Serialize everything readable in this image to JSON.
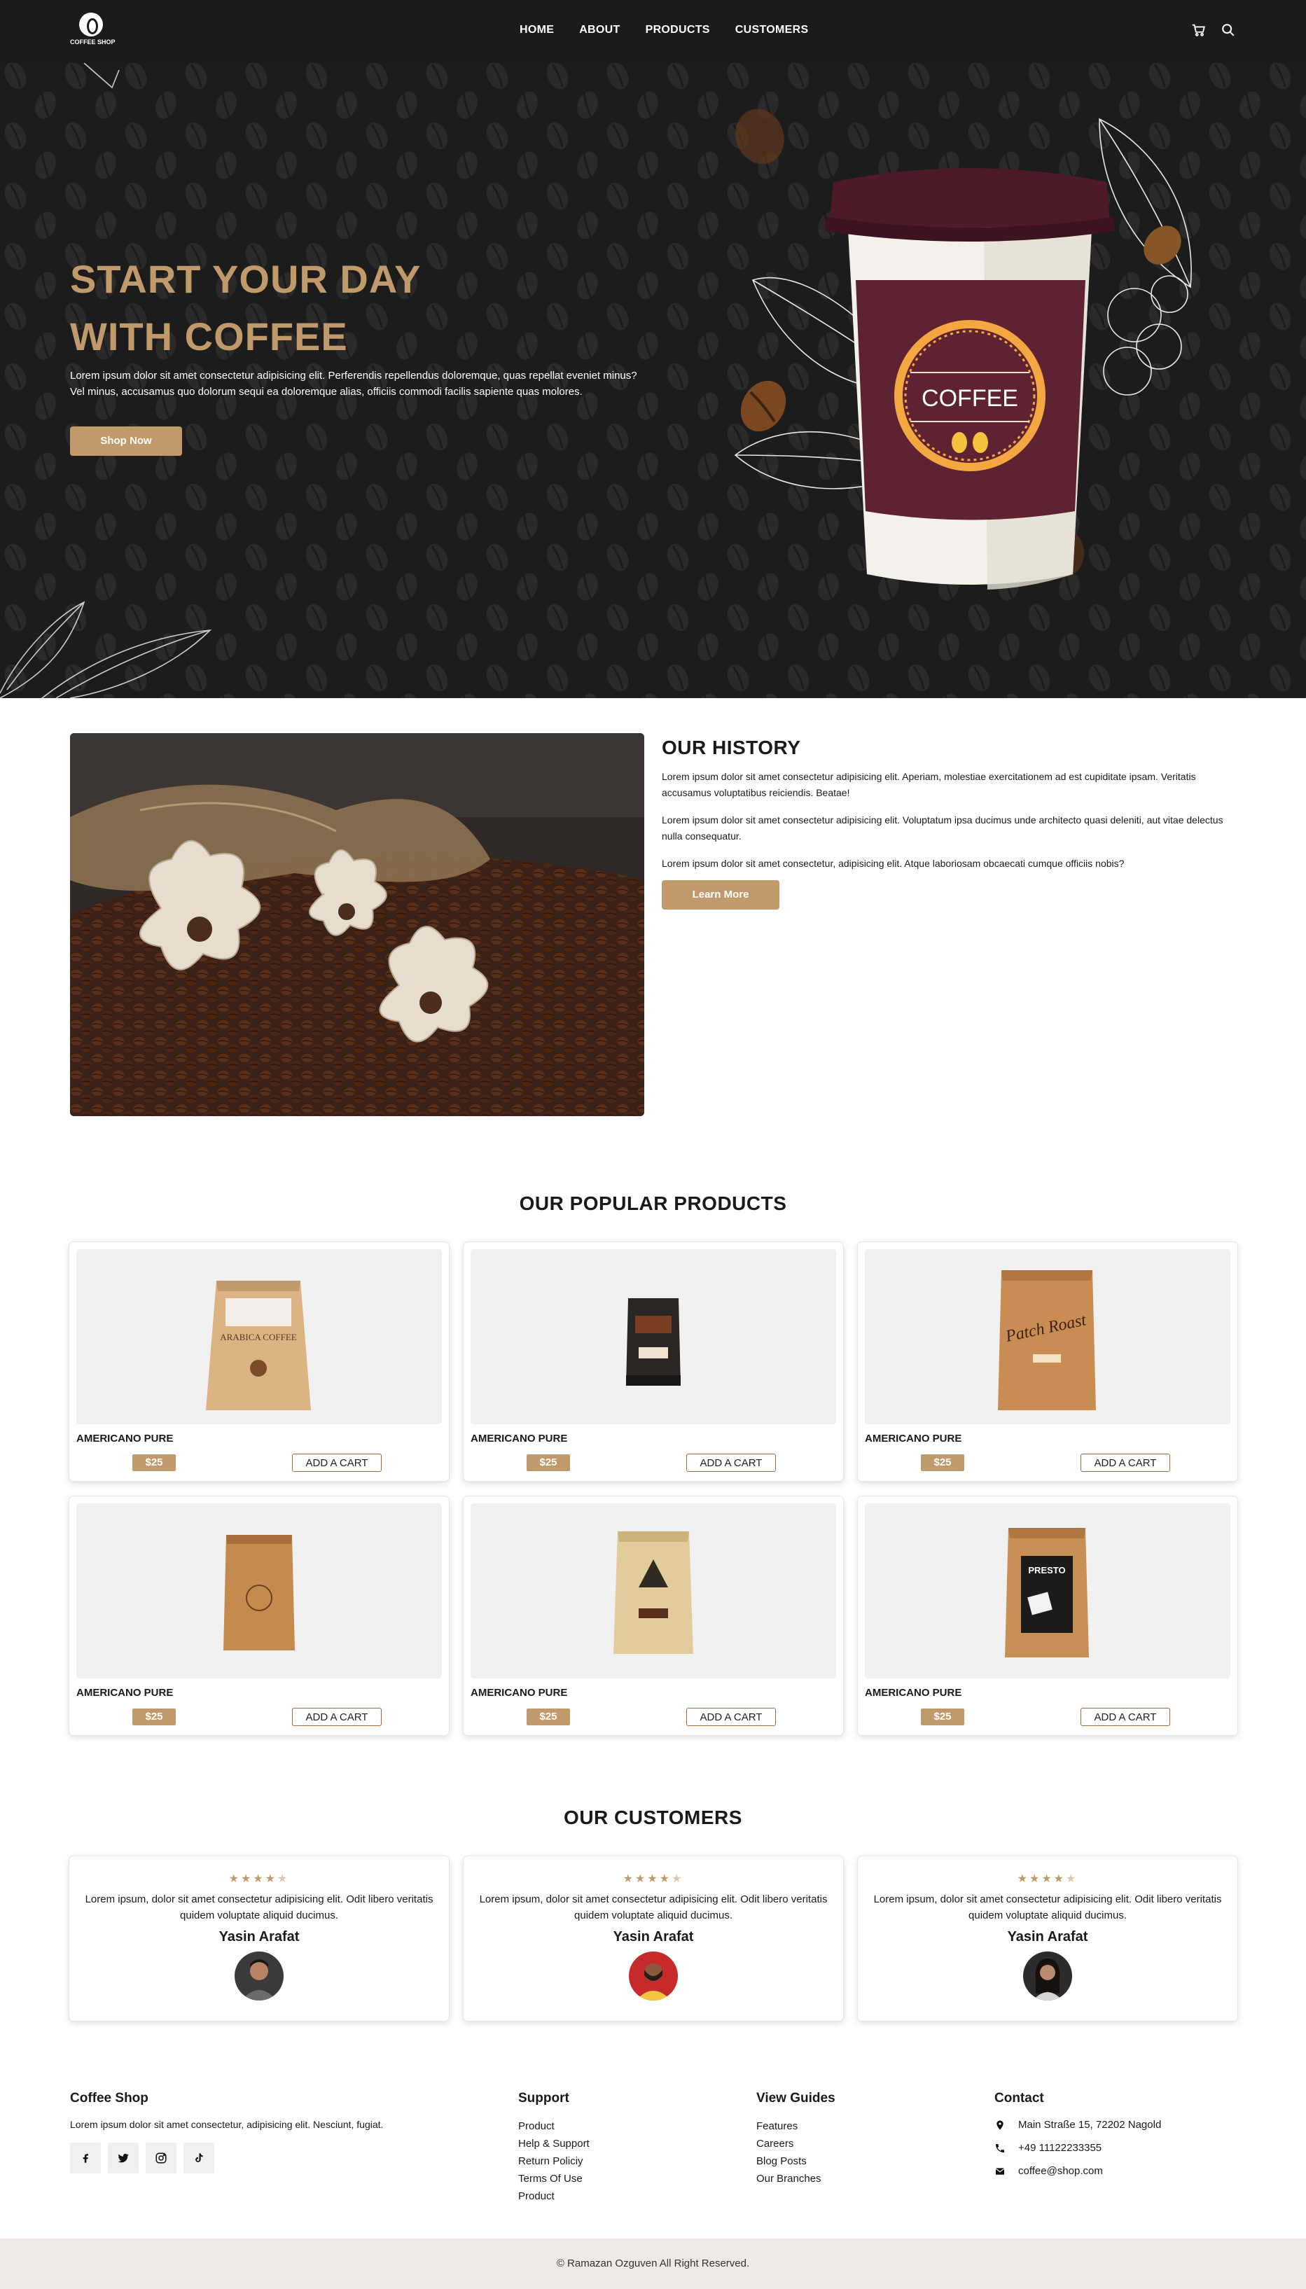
{
  "brand": {
    "logo_text": "COFFEE SHOP"
  },
  "nav": {
    "items": [
      {
        "label": "HOME"
      },
      {
        "label": "ABOUT"
      },
      {
        "label": "PRODUCTS"
      },
      {
        "label": "CUSTOMERS"
      }
    ],
    "icons": [
      "cart-icon",
      "search-icon"
    ]
  },
  "hero": {
    "title_line1": "START YOUR DAY",
    "title_line2": "WITH COFFEE",
    "text": "Lorem ipsum dolor sit amet consectetur adipisicing elit. Perferendis repellendus doloremque, quas repellat eveniet minus? Vel minus, accusamus quo dolorum sequi ea doloremque alias, officiis commodi facilis sapiente quas molores.",
    "button": "Shop Now",
    "cup_label": "COFFEE",
    "colors": {
      "accent": "#c09a6b",
      "background": "#1d1c1c",
      "cup": "#5e2232"
    }
  },
  "history": {
    "title": "OUR HISTORY",
    "paragraphs": [
      "Lorem ipsum dolor sit amet consectetur adipisicing elit. Aperiam, molestiae exercitationem ad est cupiditate ipsam. Veritatis accusamus voluptatibus reiciendis. Beatae!",
      "Lorem ipsum dolor sit amet consectetur adipisicing elit. Voluptatum ipsa ducimus unde architecto quasi deleniti, aut vitae delectus nulla consequatur.",
      "Lorem ipsum dolor sit amet consectetur, adipisicing elit. Atque laboriosam obcaecati cumque officiis nobis?"
    ],
    "button": "Learn More"
  },
  "products": {
    "title": "OUR POPULAR PRODUCTS",
    "items": [
      {
        "name": "AMERICANO PURE",
        "price": "$25",
        "button": "ADD A CART",
        "pack_text": "ARABICA COFFEE"
      },
      {
        "name": "AMERICANO PURE",
        "price": "$25",
        "button": "ADD A CART",
        "pack_text": ""
      },
      {
        "name": "AMERICANO PURE",
        "price": "$25",
        "button": "ADD A CART",
        "pack_text": "Patch Roast"
      },
      {
        "name": "AMERICANO PURE",
        "price": "$25",
        "button": "ADD A CART",
        "pack_text": ""
      },
      {
        "name": "AMERICANO PURE",
        "price": "$25",
        "button": "ADD A CART",
        "pack_text": ""
      },
      {
        "name": "AMERICANO PURE",
        "price": "$25",
        "button": "ADD A CART",
        "pack_text": "PRESTO"
      }
    ]
  },
  "customers": {
    "title": "OUR CUSTOMERS",
    "items": [
      {
        "rating": 4.5,
        "quote": "Lorem ipsum, dolor sit amet consectetur adipisicing elit. Odit libero veritatis quidem voluptate aliquid ducimus.",
        "name": "Yasin Arafat"
      },
      {
        "rating": 4.5,
        "quote": "Lorem ipsum, dolor sit amet consectetur adipisicing elit. Odit libero veritatis quidem voluptate aliquid ducimus.",
        "name": "Yasin Arafat"
      },
      {
        "rating": 4.5,
        "quote": "Lorem ipsum, dolor sit amet consectetur adipisicing elit. Odit libero veritatis quidem voluptate aliquid ducimus.",
        "name": "Yasin Arafat"
      }
    ]
  },
  "footer": {
    "about": {
      "title": "Coffee Shop",
      "text": "Lorem ipsum dolor sit amet consectetur, adipisicing elit. Nesciunt, fugiat."
    },
    "socials": [
      "facebook-icon",
      "twitter-icon",
      "instagram-icon",
      "tiktok-icon"
    ],
    "support": {
      "title": "Support",
      "links": [
        "Product",
        "Help & Support",
        "Return Policiy",
        "Terms Of Use",
        "Product"
      ]
    },
    "guides": {
      "title": "View Guides",
      "links": [
        "Features",
        "Careers",
        "Blog Posts",
        "Our Branches"
      ]
    },
    "contact": {
      "title": "Contact",
      "address": "Main Straße 15, 72202 Nagold",
      "phone": "+49 11122233355",
      "email": "coffee@shop.com"
    },
    "copyright": "© Ramazan Ozguven All Right Reserved."
  }
}
